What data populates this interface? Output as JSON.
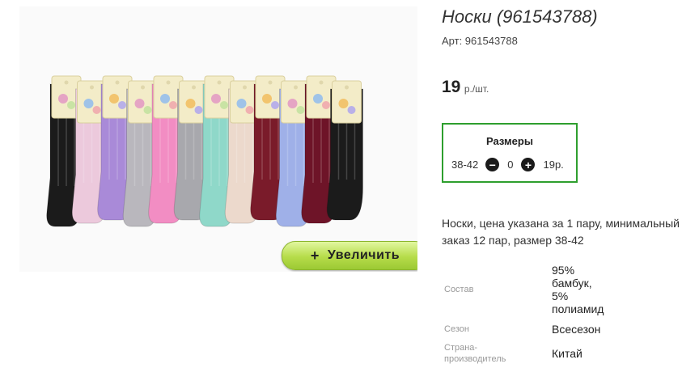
{
  "product": {
    "title": "Носки (961543788)",
    "sku": "Арт: 961543788",
    "price_value": "19",
    "price_unit": "р./шт.",
    "description": "Носки, цена указана за 1 пару, минимальный заказ 12 пар, размер 38-42"
  },
  "photo": {
    "zoom_label": "Увеличить",
    "zoom_plus": "+",
    "sock_colors": [
      "#1b1b1b",
      "#ecc9dc",
      "#a98ad8",
      "#b9b7bd",
      "#f28dc3",
      "#a8a8ad",
      "#8fd8c9",
      "#ecd9cc",
      "#7a1b2a",
      "#9fb0e8",
      "#6e1428",
      "#1b1b1b"
    ]
  },
  "sizes": {
    "title": "Размеры",
    "rows": [
      {
        "size": "38-42",
        "minus": "−",
        "qty": "0",
        "plus": "+",
        "price": "19р."
      }
    ]
  },
  "attributes": [
    {
      "label": "Состав",
      "value": [
        "95%",
        "бамбук,",
        "5%",
        "полиамид"
      ]
    },
    {
      "label": "Сезон",
      "value": [
        "Всесезон"
      ]
    },
    {
      "label": [
        "Страна-",
        "производитель"
      ],
      "value": [
        "Китай"
      ]
    }
  ]
}
